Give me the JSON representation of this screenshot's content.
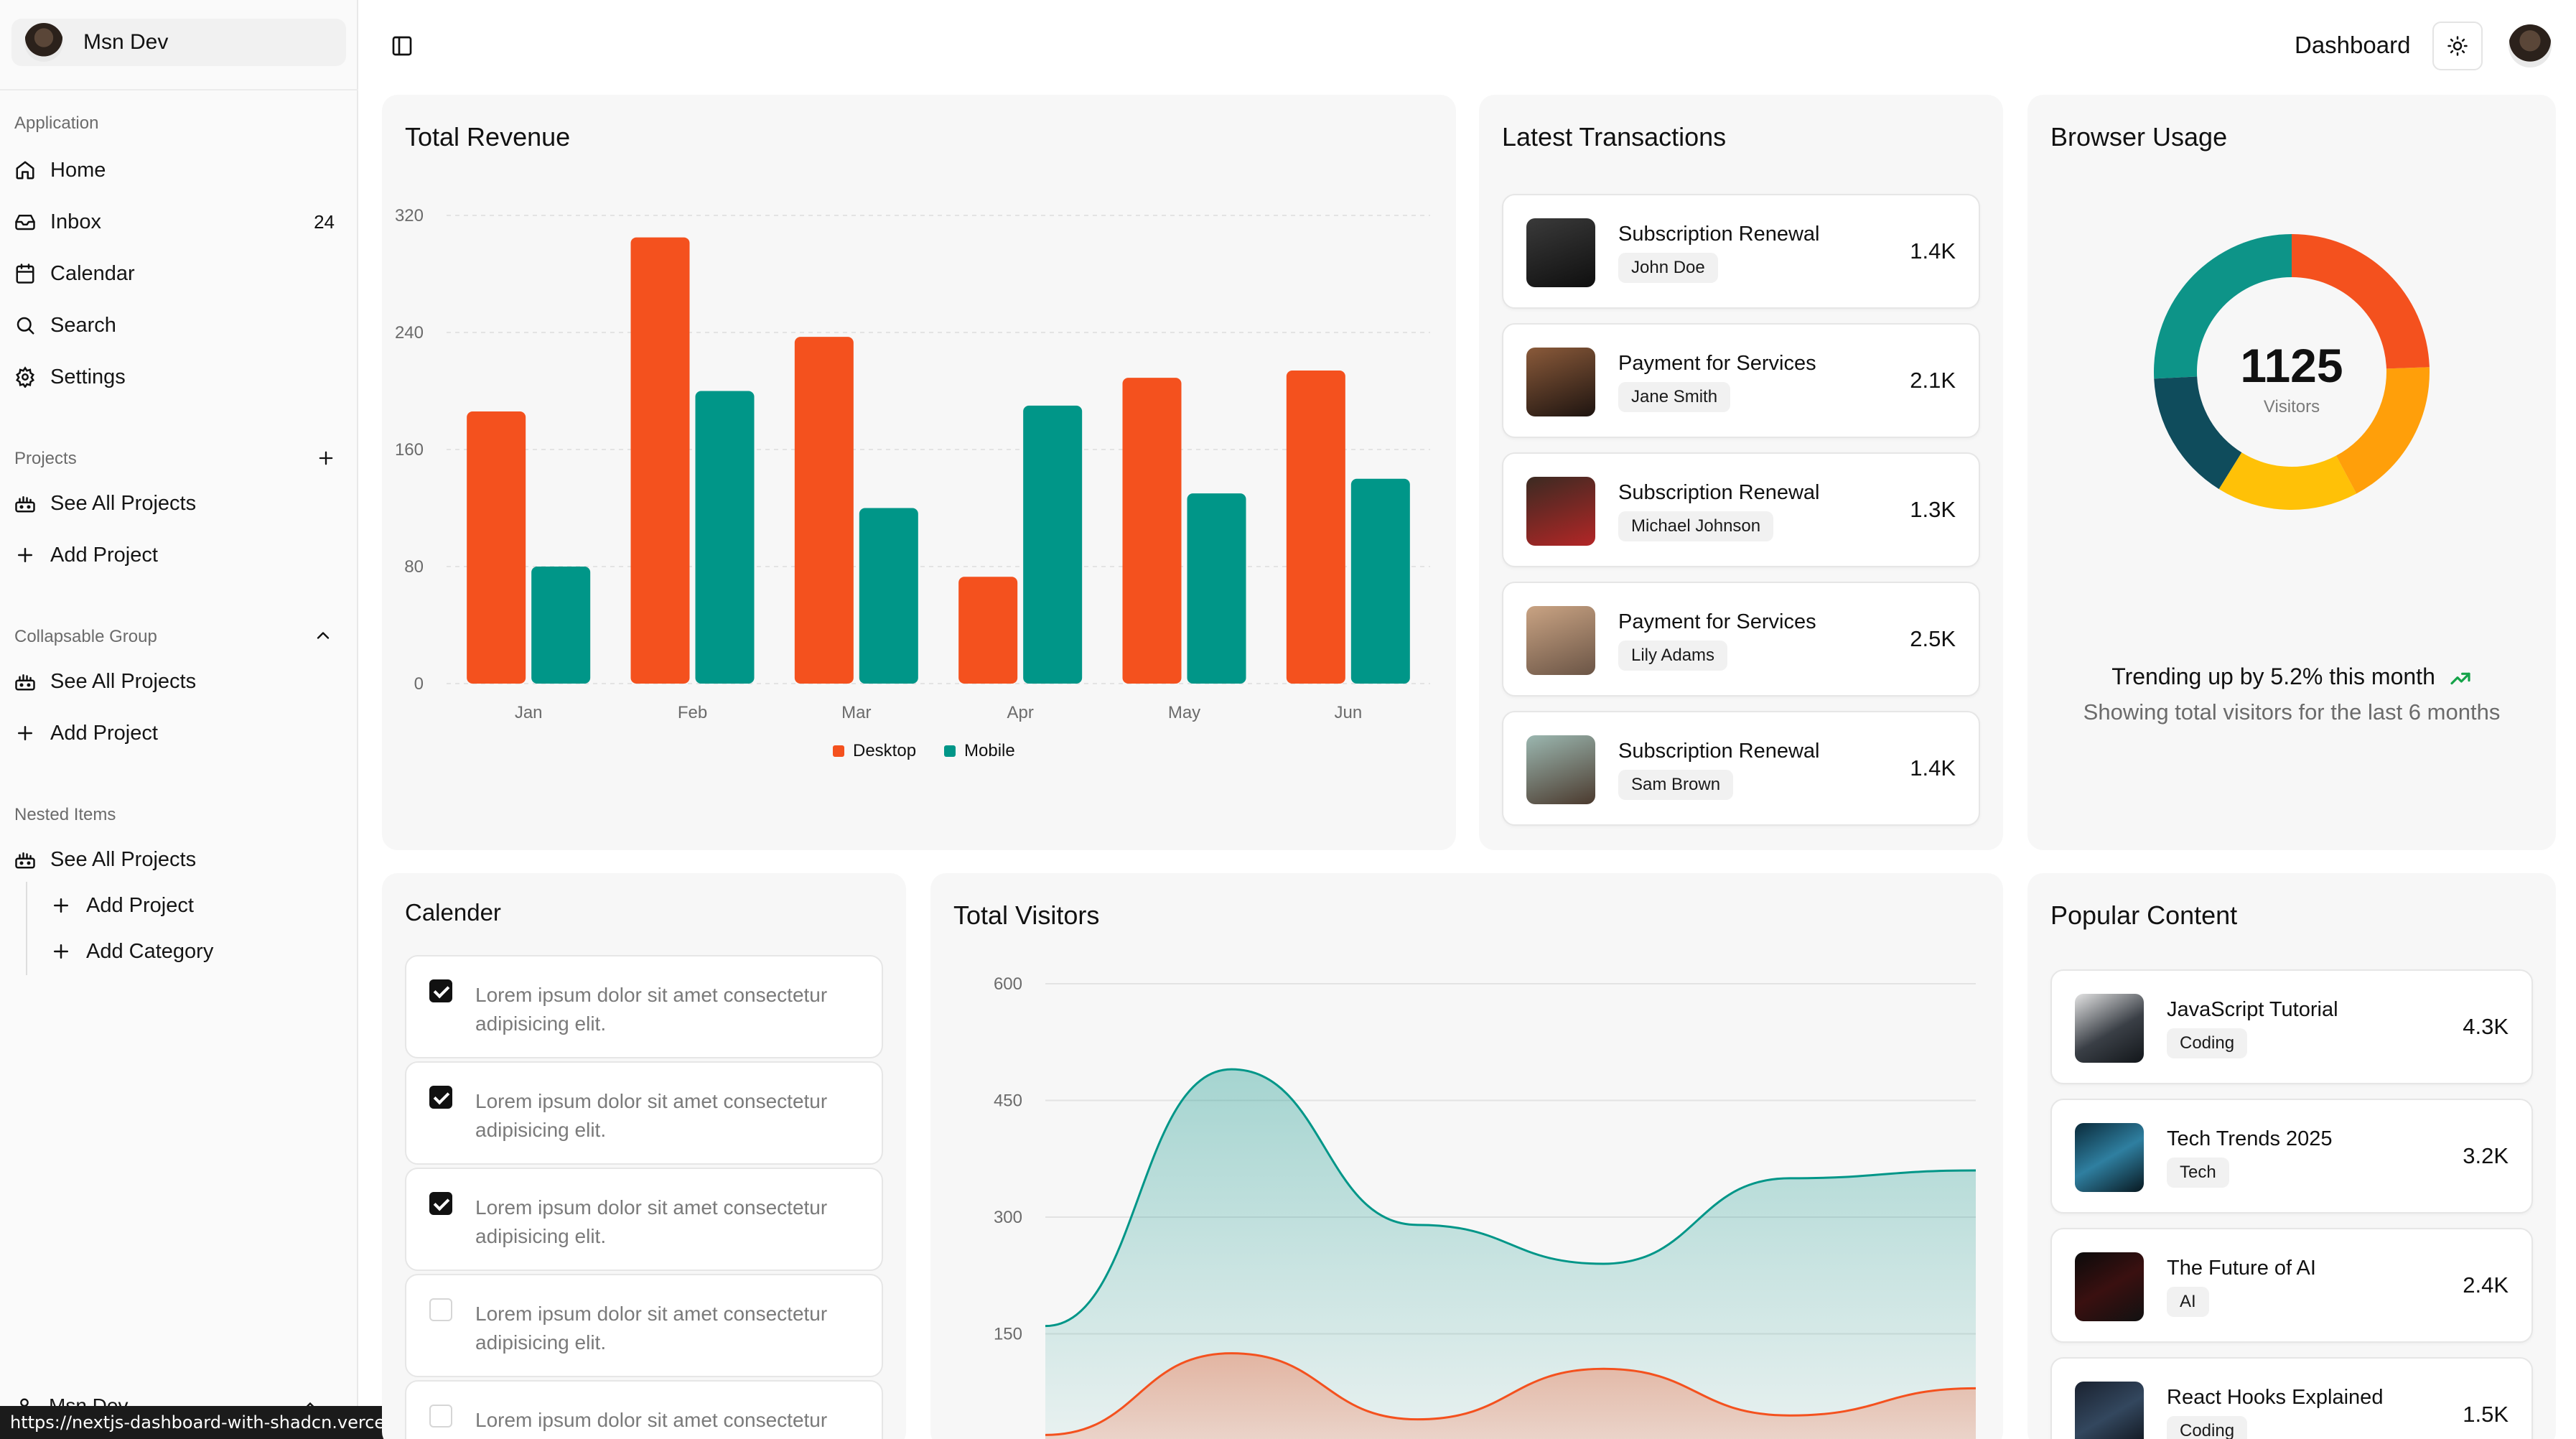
{
  "sidebar": {
    "user_name": "Msn Dev",
    "groups": {
      "application": "Application",
      "projects": "Projects",
      "collapsible": "Collapsable Group",
      "nested": "Nested Items"
    },
    "application_items": [
      {
        "label": "Home",
        "icon": "home-icon"
      },
      {
        "label": "Inbox",
        "icon": "inbox-icon",
        "badge": "24"
      },
      {
        "label": "Calendar",
        "icon": "calendar-icon"
      },
      {
        "label": "Search",
        "icon": "search-icon"
      },
      {
        "label": "Settings",
        "icon": "settings-icon"
      }
    ],
    "projects_items": [
      {
        "label": "See All Projects",
        "icon": "projects-icon"
      },
      {
        "label": "Add Project",
        "icon": "plus-icon"
      }
    ],
    "collapsible_items": [
      {
        "label": "See All Projects",
        "icon": "projects-icon"
      },
      {
        "label": "Add Project",
        "icon": "plus-icon"
      }
    ],
    "nested_items": [
      {
        "label": "See All Projects",
        "icon": "projects-icon"
      },
      {
        "label": "Add Project",
        "icon": "plus-icon"
      },
      {
        "label": "Add Category",
        "icon": "plus-icon"
      }
    ],
    "footer_user": "Msn Dev"
  },
  "status_url": "https://nextjs-dashboard-with-shadcn.vercel.app/#",
  "header": {
    "breadcrumb": "Dashboard"
  },
  "revenue": {
    "title": "Total Revenue",
    "legend": [
      "Desktop",
      "Mobile"
    ]
  },
  "transactions": {
    "title": "Latest Transactions",
    "items": [
      {
        "title": "Subscription Renewal",
        "name": "John Doe",
        "amount": "1.4K"
      },
      {
        "title": "Payment for Services",
        "name": "Jane Smith",
        "amount": "2.1K"
      },
      {
        "title": "Subscription Renewal",
        "name": "Michael Johnson",
        "amount": "1.3K"
      },
      {
        "title": "Payment for Services",
        "name": "Lily Adams",
        "amount": "2.5K"
      },
      {
        "title": "Subscription Renewal",
        "name": "Sam Brown",
        "amount": "1.4K"
      }
    ]
  },
  "browser": {
    "title": "Browser Usage",
    "total": "1125",
    "total_label": "Visitors",
    "trend": "Trending up by 5.2% this month",
    "subtitle": "Showing total visitors for the last 6 months"
  },
  "calendar": {
    "title": "Calender",
    "todos": [
      {
        "text": "Lorem ipsum dolor sit amet consectetur adipisicing elit.",
        "checked": true
      },
      {
        "text": "Lorem ipsum dolor sit amet consectetur adipisicing elit.",
        "checked": true
      },
      {
        "text": "Lorem ipsum dolor sit amet consectetur adipisicing elit.",
        "checked": true
      },
      {
        "text": "Lorem ipsum dolor sit amet consectetur adipisicing elit.",
        "checked": false
      },
      {
        "text": "Lorem ipsum dolor sit amet consectetur",
        "checked": false
      }
    ]
  },
  "visitors": {
    "title": "Total Visitors"
  },
  "popular": {
    "title": "Popular Content",
    "items": [
      {
        "title": "JavaScript Tutorial",
        "tag": "Coding",
        "value": "4.3K"
      },
      {
        "title": "Tech Trends 2025",
        "tag": "Tech",
        "value": "3.2K"
      },
      {
        "title": "The Future of AI",
        "tag": "AI",
        "value": "2.4K"
      },
      {
        "title": "React Hooks Explained",
        "tag": "Coding",
        "value": "1.5K"
      }
    ]
  },
  "colors": {
    "desktop": "#f4511e",
    "mobile": "#009688",
    "donut": [
      "#f4511e",
      "#ff9f0a",
      "#ffc107",
      "#0f4c5c",
      "#0d9488"
    ]
  },
  "chart_data": [
    {
      "type": "bar",
      "title": "Total Revenue",
      "categories": [
        "Jan",
        "Feb",
        "Mar",
        "Apr",
        "May",
        "Jun"
      ],
      "series": [
        {
          "name": "Desktop",
          "values": [
            186,
            305,
            237,
            73,
            209,
            214
          ]
        },
        {
          "name": "Mobile",
          "values": [
            80,
            200,
            120,
            190,
            130,
            140
          ]
        }
      ],
      "ylim": [
        0,
        320
      ],
      "yticks": [
        0,
        80,
        160,
        240,
        320
      ],
      "grid": true,
      "legend": "bottom"
    },
    {
      "type": "pie",
      "title": "Browser Usage",
      "values": [
        275,
        200,
        187,
        173,
        290
      ],
      "center_value": 1125,
      "center_label": "Visitors"
    },
    {
      "type": "area",
      "title": "Total Visitors",
      "x": [
        0,
        1,
        2,
        3,
        4,
        5
      ],
      "series": [
        {
          "values": [
            160,
            490,
            290,
            240,
            350,
            360
          ]
        },
        {
          "values": [
            20,
            125,
            40,
            105,
            45,
            80
          ]
        }
      ],
      "ylim": [
        0,
        600
      ],
      "yticks": [
        150,
        300,
        450,
        600
      ],
      "grid": true
    }
  ]
}
